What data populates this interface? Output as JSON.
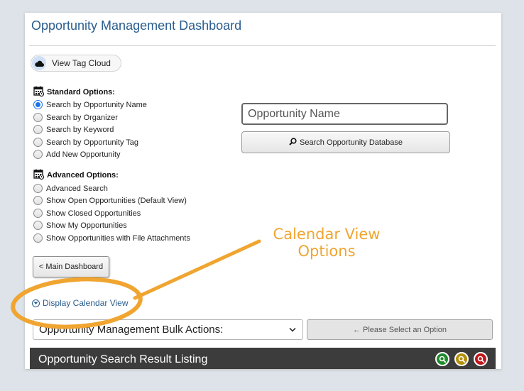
{
  "header": {
    "title": "Opportunity Management Dashboard"
  },
  "tag_cloud": {
    "label": "View Tag Cloud",
    "icon": "cloud-icon"
  },
  "standard_options": {
    "heading": "Standard Options:",
    "items": [
      {
        "label": "Search by Opportunity Name",
        "selected": true
      },
      {
        "label": "Search by Organizer",
        "selected": false
      },
      {
        "label": "Search by Keyword",
        "selected": false
      },
      {
        "label": "Search by Opportunity Tag",
        "selected": false
      },
      {
        "label": "Add New Opportunity",
        "selected": false
      }
    ]
  },
  "advanced_options": {
    "heading": "Advanced Options:",
    "items": [
      {
        "label": "Advanced Search",
        "selected": false
      },
      {
        "label": "Show Open Opportunities (Default View)",
        "selected": false
      },
      {
        "label": "Show Closed Opportunities",
        "selected": false
      },
      {
        "label": "Show My Opportunities",
        "selected": false
      },
      {
        "label": "Show Opportunities with File Attachments",
        "selected": false
      }
    ]
  },
  "search": {
    "placeholder": "Opportunity Name",
    "value": "",
    "button_label": "Search Opportunity Database"
  },
  "main_dashboard_button": "< Main Dashboard",
  "calendar_link": "Display Calendar View",
  "bulk_actions": {
    "selected": "Opportunity Management Bulk Actions:",
    "button_label": "← Please Select an Option"
  },
  "results": {
    "title": "Opportunity Search Result Listing",
    "icon_colors": [
      "#1f8a2c",
      "#b38f0a",
      "#c0171c"
    ]
  },
  "annotation": {
    "line1": "Calendar View",
    "line2": "Options",
    "color": "#f0a531"
  }
}
